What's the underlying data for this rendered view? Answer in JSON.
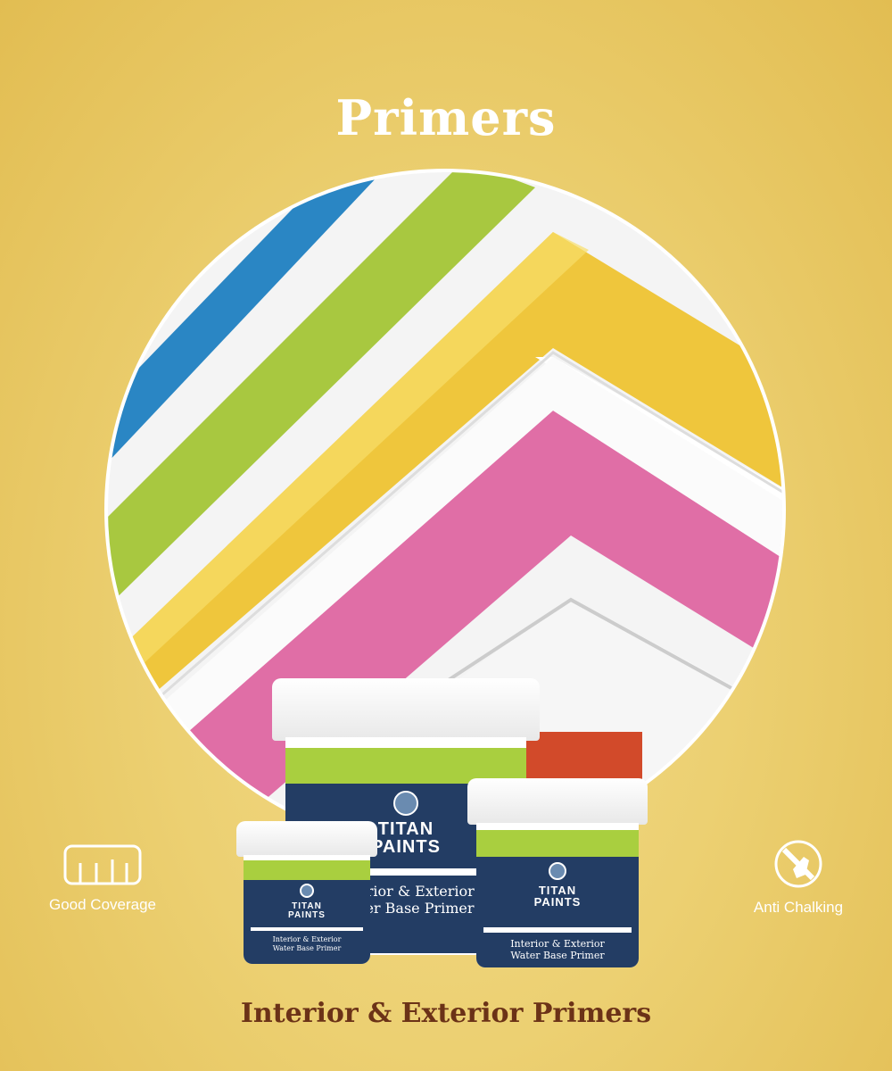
{
  "header": {
    "title": "Primers"
  },
  "features": [
    {
      "label": "Good Coverage",
      "icon": "ruler-coverage-icon"
    },
    {
      "label": "Anti Chalking",
      "icon": "no-chalk-hand-icon"
    }
  ],
  "product": {
    "brand_line1": "TITAN",
    "brand_line2": "PAINTS",
    "name_line1": "Interior & Exterior",
    "name_line2": "Water Base Primer"
  },
  "footer": {
    "tagline": "Interior & Exterior Primers"
  },
  "colors": {
    "background": "#ecd072",
    "title": "#ffffff",
    "tagline": "#6b3217",
    "navy": "#233d64",
    "green": "#a9cf3f"
  }
}
